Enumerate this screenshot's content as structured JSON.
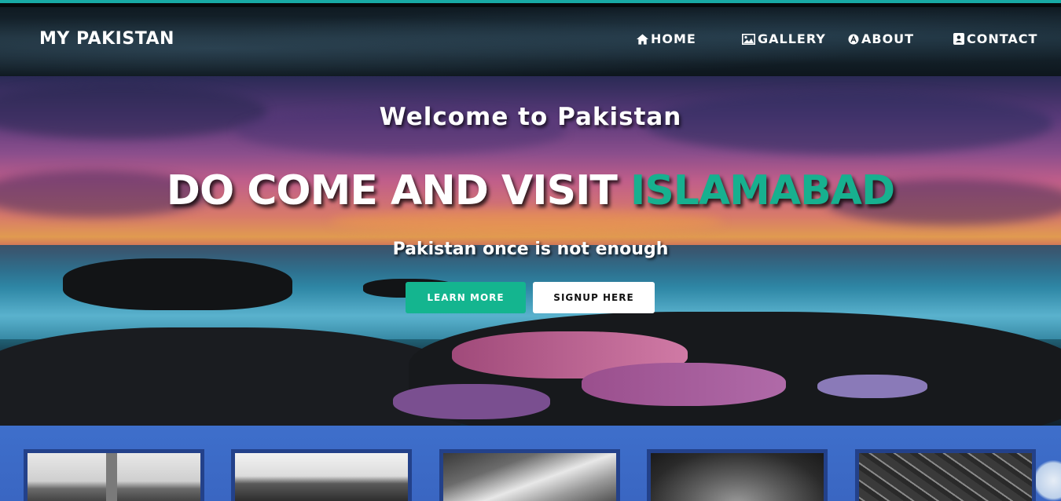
{
  "brand": "MY PAKISTAN",
  "nav": {
    "home": "HOME",
    "gallery": "GALLERY",
    "about": "ABOUT",
    "contact": "CONTACT"
  },
  "hero": {
    "subtitle": "Welcome to Pakistan",
    "title_prefix": "DO COME AND VISIT",
    "title_accent": "ISLAMABAD",
    "tagline": "Pakistan once is not enough",
    "learn_more": "LEARN MORE",
    "signup": "SIGNUP HERE"
  },
  "colors": {
    "accent": "#17b08f",
    "strip": "#3e6fcb",
    "thumb_border": "#23418a"
  },
  "icons": {
    "home": "home-icon",
    "gallery": "image-icon",
    "about": "info-circle-icon",
    "contact": "contact-card-icon"
  }
}
